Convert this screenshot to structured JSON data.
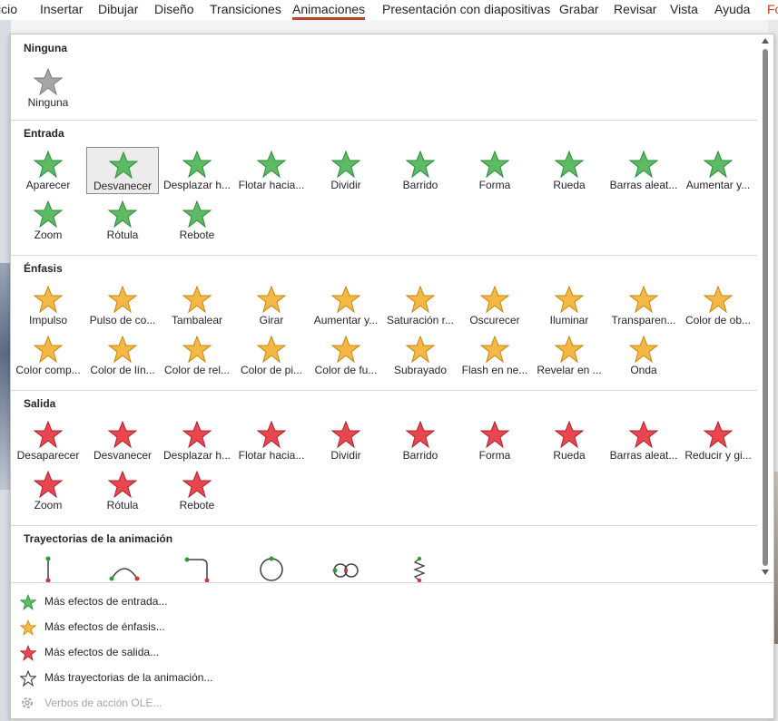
{
  "ribbon": {
    "tabs": [
      "icio",
      "Insertar",
      "Dibujar",
      "Diseño",
      "Transiciones",
      "Animaciones",
      "Presentación con diapositivas",
      "Grabar",
      "Revisar",
      "Vista",
      "Ayuda",
      "Fo"
    ],
    "active": "Animaciones"
  },
  "sections": {
    "ninguna": {
      "title": "Ninguna",
      "items": [
        "Ninguna"
      ]
    },
    "entrada": {
      "title": "Entrada",
      "items": [
        "Aparecer",
        "Desvanecer",
        "Desplazar h...",
        "Flotar hacia...",
        "Dividir",
        "Barrido",
        "Forma",
        "Rueda",
        "Barras aleat...",
        "Aumentar y...",
        "Zoom",
        "Rótula",
        "Rebote"
      ],
      "selected": "Desvanecer"
    },
    "enfasis": {
      "title": "Énfasis",
      "items": [
        "Impulso",
        "Pulso de co...",
        "Tambalear",
        "Girar",
        "Aumentar y...",
        "Saturación r...",
        "Oscurecer",
        "Iluminar",
        "Transparen...",
        "Color de ob...",
        "Color comp...",
        "Color de lín...",
        "Color de rel...",
        "Color de pi...",
        "Color de fu...",
        "Subrayado",
        "Flash en ne...",
        "Revelar en ...",
        "Onda"
      ]
    },
    "salida": {
      "title": "Salida",
      "items": [
        "Desaparecer",
        "Desvanecer",
        "Desplazar h...",
        "Flotar hacia...",
        "Dividir",
        "Barrido",
        "Forma",
        "Rueda",
        "Barras aleat...",
        "Reducir y gi...",
        "Zoom",
        "Rótula",
        "Rebote"
      ]
    },
    "trayectorias": {
      "title": "Trayectorias de la animación"
    }
  },
  "menu": [
    {
      "label": "Más efectos de entrada...",
      "icon": "green-star-icon",
      "enabled": true
    },
    {
      "label": "Más efectos de énfasis...",
      "icon": "orange-burst-icon",
      "enabled": true
    },
    {
      "label": "Más efectos de salida...",
      "icon": "red-star-icon",
      "enabled": true
    },
    {
      "label": "Más trayectorias de la animación...",
      "icon": "outline-star-icon",
      "enabled": true
    },
    {
      "label": "Verbos de acción OLE...",
      "icon": "gear-icon",
      "enabled": false
    }
  ],
  "colors": {
    "entrada": "#5dbb63",
    "enfasis": "#f5b845",
    "salida": "#e8474f",
    "ninguna": "#a6a6a6",
    "accent": "#b7472a"
  }
}
